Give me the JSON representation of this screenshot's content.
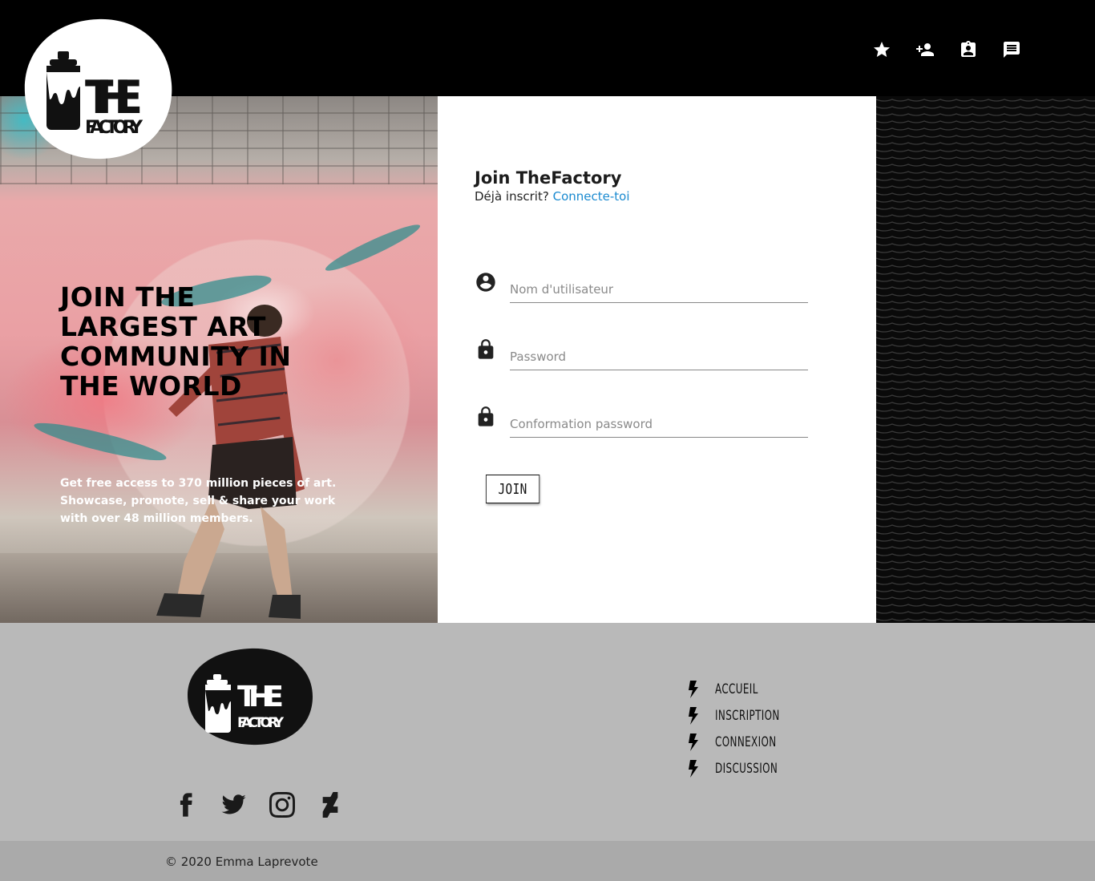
{
  "header": {
    "nav_icons": [
      "star-icon",
      "add-user-icon",
      "contact-card-icon",
      "message-icon"
    ]
  },
  "brand": {
    "logo_word_1": "THE",
    "logo_word_2": "FACTORY"
  },
  "hero": {
    "title": "JOIN THE LARGEST ART COMMUNITY IN THE WORLD",
    "subtitle": "Get free access to 370 million pieces of art. Showcase, promote, sell & share your work with over 48 million members."
  },
  "form": {
    "title": "Join TheFactory",
    "already_text": "Déjà inscrit? ",
    "login_link": "Connecte-toi",
    "username_placeholder": "Nom d'utilisateur",
    "password_placeholder": "Password",
    "confirm_placeholder": "Conformation password",
    "join_label": "JOIN"
  },
  "footer": {
    "links": [
      "ACCUEIL",
      "INSCRIPTION",
      "CONNEXION",
      "DISCUSSION"
    ],
    "social": [
      "facebook-icon",
      "twitter-icon",
      "instagram-icon",
      "deviantart-icon"
    ],
    "copyright": "© 2020 Emma Laprevote"
  },
  "colors": {
    "link": "#1a8ad0",
    "header_bg": "#000000",
    "footer_bg": "#b9b9b9",
    "copyright_bg": "#aaaaaa"
  }
}
